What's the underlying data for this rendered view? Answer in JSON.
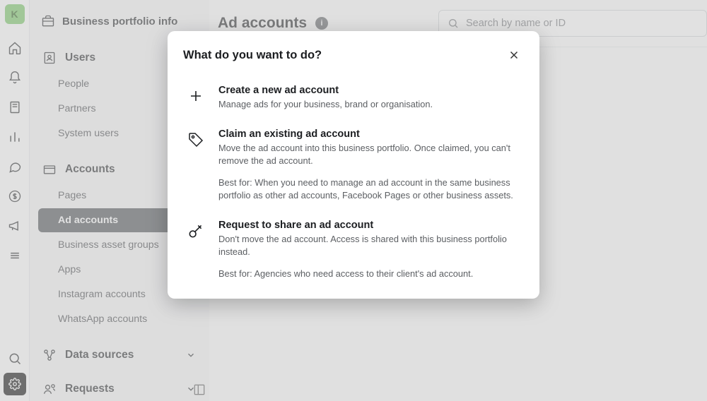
{
  "rail": {
    "logo": "K"
  },
  "sidebar": {
    "title": "Business portfolio info",
    "sections": {
      "users": {
        "label": "Users",
        "items": [
          "People",
          "Partners",
          "System users"
        ]
      },
      "accounts": {
        "label": "Accounts",
        "items": [
          "Pages",
          "Ad accounts",
          "Business asset groups",
          "Apps",
          "Instagram accounts",
          "WhatsApp accounts"
        ]
      },
      "data_sources": {
        "label": "Data sources"
      },
      "requests": {
        "label": "Requests"
      }
    }
  },
  "main": {
    "title": "Ad accounts",
    "search_placeholder": "Search by name or ID"
  },
  "modal": {
    "title": "What do you want to do?",
    "options": {
      "create": {
        "title": "Create a new ad account",
        "desc": "Manage ads for your business, brand or organisation."
      },
      "claim": {
        "title": "Claim an existing ad account",
        "desc": "Move the ad account into this business portfolio. Once claimed, you can't remove the ad account.",
        "best": "Best for: When you need to manage an ad account in the same business portfolio as other ad accounts, Facebook Pages or other business assets."
      },
      "share": {
        "title": "Request to share an ad account",
        "desc": "Don't move the ad account. Access is shared with this business portfolio instead.",
        "best": "Best for: Agencies who need access to their client's ad account."
      }
    }
  }
}
